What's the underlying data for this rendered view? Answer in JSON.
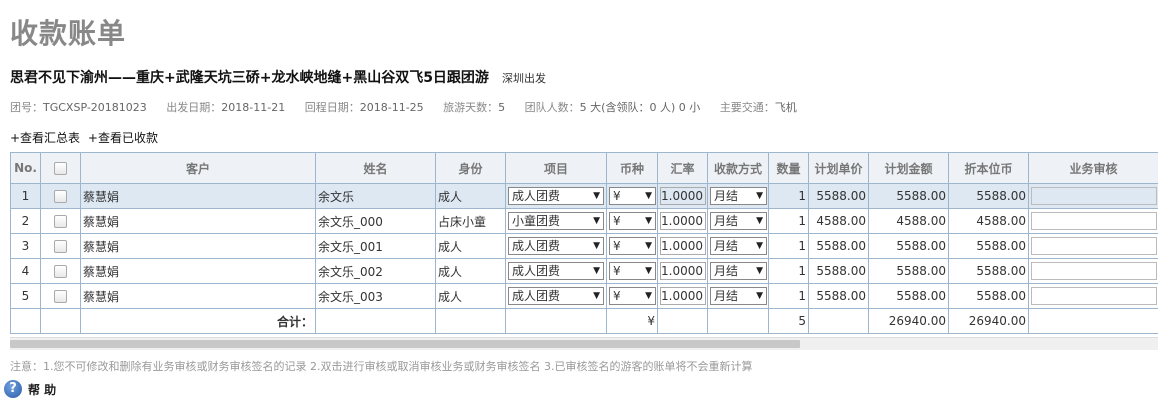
{
  "page_title": "收款账单",
  "tour": {
    "name": "思君不见下渝州——重庆+武隆天坑三硚+龙水峡地缝+黑山谷双飞5日跟团游",
    "departure": "深圳出发"
  },
  "info": {
    "group_label": "团号：",
    "group_value": "TGCXSP-20181023",
    "depart_label": "出发日期：",
    "depart_value": "2018-11-21",
    "return_label": "回程日期：",
    "return_value": "2018-11-25",
    "days_label": "旅游天数：",
    "days_value": "5",
    "people_label": "团队人数：",
    "people_value": "5 大(含领队：0 人) 0 小",
    "transport_label": "主要交通：",
    "transport_value": "飞机"
  },
  "links": {
    "summary": "+查看汇总表",
    "received": "+查看已收款"
  },
  "columns": [
    "No.",
    "",
    "客户",
    "姓名",
    "身份",
    "项目",
    "币种",
    "汇率",
    "收款方式",
    "数量",
    "计划单价",
    "计划金额",
    "折本位币",
    "业务审核"
  ],
  "rows": [
    {
      "no": "1",
      "customer": "蔡慧娟",
      "name": "余文乐",
      "identity": "成人",
      "item": "成人团费",
      "currency": "¥",
      "rate": "1.0000",
      "method": "月结",
      "qty": "1",
      "unit": "5588.00",
      "amount": "5588.00",
      "base": "5588.00"
    },
    {
      "no": "2",
      "customer": "蔡慧娟",
      "name": "余文乐_000",
      "identity": "占床小童",
      "item": "小童团费",
      "currency": "¥",
      "rate": "1.0000",
      "method": "月结",
      "qty": "1",
      "unit": "4588.00",
      "amount": "4588.00",
      "base": "4588.00"
    },
    {
      "no": "3",
      "customer": "蔡慧娟",
      "name": "余文乐_001",
      "identity": "成人",
      "item": "成人团费",
      "currency": "¥",
      "rate": "1.0000",
      "method": "月结",
      "qty": "1",
      "unit": "5588.00",
      "amount": "5588.00",
      "base": "5588.00"
    },
    {
      "no": "4",
      "customer": "蔡慧娟",
      "name": "余文乐_002",
      "identity": "成人",
      "item": "成人团费",
      "currency": "¥",
      "rate": "1.0000",
      "method": "月结",
      "qty": "1",
      "unit": "5588.00",
      "amount": "5588.00",
      "base": "5588.00"
    },
    {
      "no": "5",
      "customer": "蔡慧娟",
      "name": "余文乐_003",
      "identity": "成人",
      "item": "成人团费",
      "currency": "¥",
      "rate": "1.0000",
      "method": "月结",
      "qty": "1",
      "unit": "5588.00",
      "amount": "5588.00",
      "base": "5588.00"
    }
  ],
  "total": {
    "label": "合计：",
    "currency": "¥",
    "qty": "5",
    "amount": "26940.00",
    "base": "26940.00"
  },
  "note": "注意：1.您不可修改和删除有业务审核或财务审核签名的记录    2.双击进行审核或取消审核业务或财务审核签名    3.已审核签名的游客的账单将不会重新计算",
  "help_label": "帮 助",
  "icons": {
    "select_arrow": "chevron-down-icon",
    "help": "help-icon",
    "checkbox": "checkbox-icon"
  }
}
